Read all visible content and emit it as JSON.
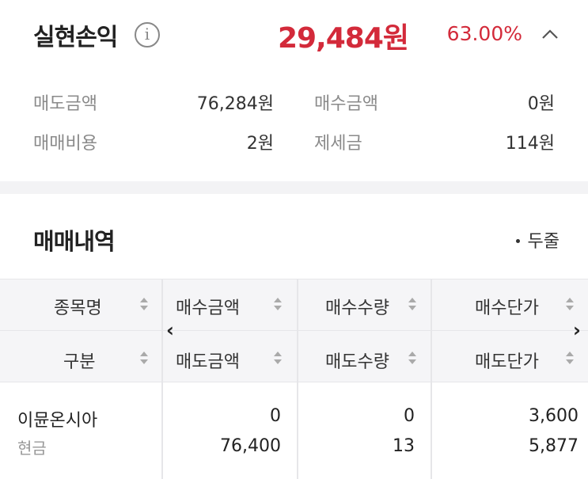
{
  "summary": {
    "title": "실현손익",
    "info_icon": "info-icon",
    "profit_amount": "29,484원",
    "profit_rate": "63.00%",
    "collapse_icon": "chevron-up-icon",
    "accent_color": "#d32a3a",
    "items": [
      {
        "label": "매도금액",
        "value": "76,284원"
      },
      {
        "label": "매수금액",
        "value": "0원"
      },
      {
        "label": "매매비용",
        "value": "2원"
      },
      {
        "label": "제세금",
        "value": "114원"
      }
    ]
  },
  "history": {
    "title": "매매내역",
    "view_toggle": "두줄",
    "header": {
      "row1": [
        "종목명",
        "매수금액",
        "매수수량",
        "매수단가"
      ],
      "row2": [
        "구분",
        "매도금액",
        "매도수량",
        "매도단가"
      ]
    },
    "rows": [
      {
        "name": "이뮨온시아",
        "type": "현금",
        "buy_amount": "0",
        "sell_amount": "76,400",
        "buy_qty": "0",
        "sell_qty": "13",
        "buy_price": "3,600",
        "sell_price": "5,877"
      }
    ]
  }
}
